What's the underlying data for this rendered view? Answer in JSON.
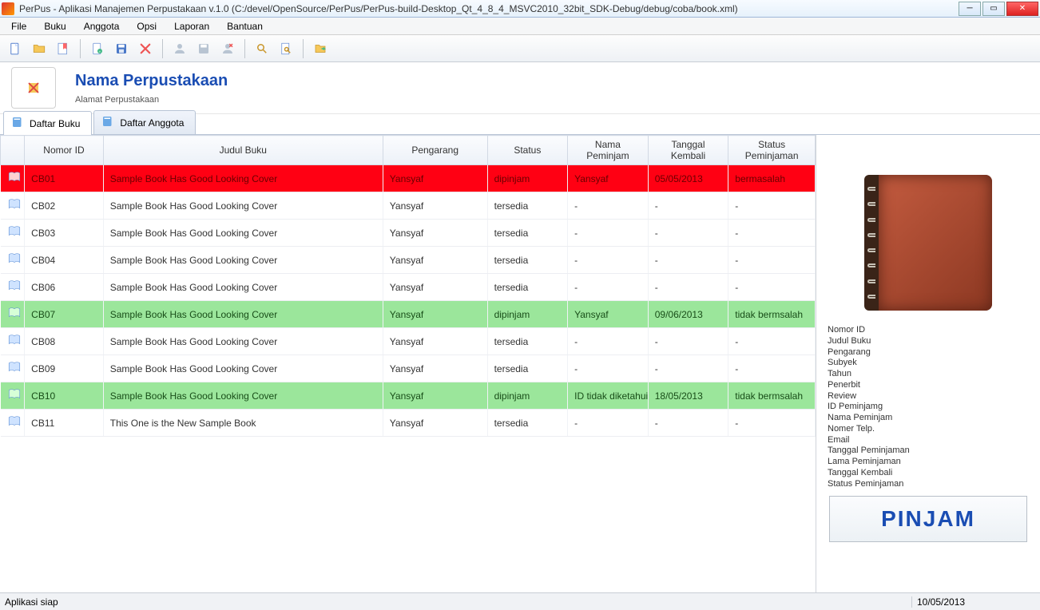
{
  "window": {
    "title": "PerPus - Aplikasi Manajemen Perpustakaan v.1.0 (C:/devel/OpenSource/PerPus/PerPus-build-Desktop_Qt_4_8_4_MSVC2010_32bit_SDK-Debug/debug/coba/book.xml)"
  },
  "menu": [
    "File",
    "Buku",
    "Anggota",
    "Opsi",
    "Laporan",
    "Bantuan"
  ],
  "header": {
    "title": "Nama Perpustakaan",
    "subtitle": "Alamat Perpustakaan"
  },
  "tabs": [
    {
      "label": "Daftar Buku",
      "active": true
    },
    {
      "label": "Daftar Anggota",
      "active": false
    }
  ],
  "columns": [
    "",
    "Nomor ID",
    "Judul Buku",
    "Pengarang",
    "Status",
    "Nama Peminjam",
    "Tanggal Kembali",
    "Status Peminjaman"
  ],
  "rows": [
    {
      "style": "red",
      "id": "CB01",
      "judul": "Sample Book Has Good Looking Cover",
      "pengarang": "Yansyaf",
      "status": "dipinjam",
      "nama": "Yansyaf",
      "tgl": "05/05/2013",
      "sp": "bermasalah"
    },
    {
      "style": "normal",
      "id": "CB02",
      "judul": "Sample Book Has Good Looking Cover",
      "pengarang": "Yansyaf",
      "status": "tersedia",
      "nama": "-",
      "tgl": "-",
      "sp": "-"
    },
    {
      "style": "normal",
      "id": "CB03",
      "judul": "Sample Book Has Good Looking Cover",
      "pengarang": "Yansyaf",
      "status": "tersedia",
      "nama": "-",
      "tgl": "-",
      "sp": "-"
    },
    {
      "style": "normal",
      "id": "CB04",
      "judul": "Sample Book Has Good Looking Cover",
      "pengarang": "Yansyaf",
      "status": "tersedia",
      "nama": "-",
      "tgl": "-",
      "sp": "-"
    },
    {
      "style": "normal",
      "id": "CB06",
      "judul": "Sample Book Has Good Looking Cover",
      "pengarang": "Yansyaf",
      "status": "tersedia",
      "nama": "-",
      "tgl": "-",
      "sp": "-"
    },
    {
      "style": "green",
      "id": "CB07",
      "judul": "Sample Book Has Good Looking Cover",
      "pengarang": "Yansyaf",
      "status": "dipinjam",
      "nama": "Yansyaf",
      "tgl": "09/06/2013",
      "sp": "tidak bermsalah"
    },
    {
      "style": "normal",
      "id": "CB08",
      "judul": "Sample Book Has Good Looking Cover",
      "pengarang": "Yansyaf",
      "status": "tersedia",
      "nama": "-",
      "tgl": "-",
      "sp": "-"
    },
    {
      "style": "normal",
      "id": "CB09",
      "judul": "Sample Book Has Good Looking Cover",
      "pengarang": "Yansyaf",
      "status": "tersedia",
      "nama": "-",
      "tgl": "-",
      "sp": "-"
    },
    {
      "style": "green",
      "id": "CB10",
      "judul": "Sample Book Has Good Looking Cover",
      "pengarang": "Yansyaf",
      "status": "dipinjam",
      "nama": "ID tidak diketahui",
      "tgl": "18/05/2013",
      "sp": "tidak bermsalah"
    },
    {
      "style": "normal",
      "id": "CB11",
      "judul": "This One is the New Sample Book",
      "pengarang": "Yansyaf",
      "status": "tersedia",
      "nama": "-",
      "tgl": "-",
      "sp": "-"
    }
  ],
  "detail_labels": [
    "Nomor ID",
    "Judul Buku",
    "Pengarang",
    "Subyek",
    "Tahun",
    "Penerbit",
    "Review",
    "ID Peminjamg",
    "Nama Peminjam",
    "Nomer Telp.",
    "Email",
    "Tanggal Peminjaman",
    "Lama Peminjaman",
    "Tanggal Kembali",
    "Status Peminjaman"
  ],
  "pinjam_button": "PINJAM",
  "status": {
    "left": "Aplikasi siap",
    "right": "10/05/2013"
  }
}
